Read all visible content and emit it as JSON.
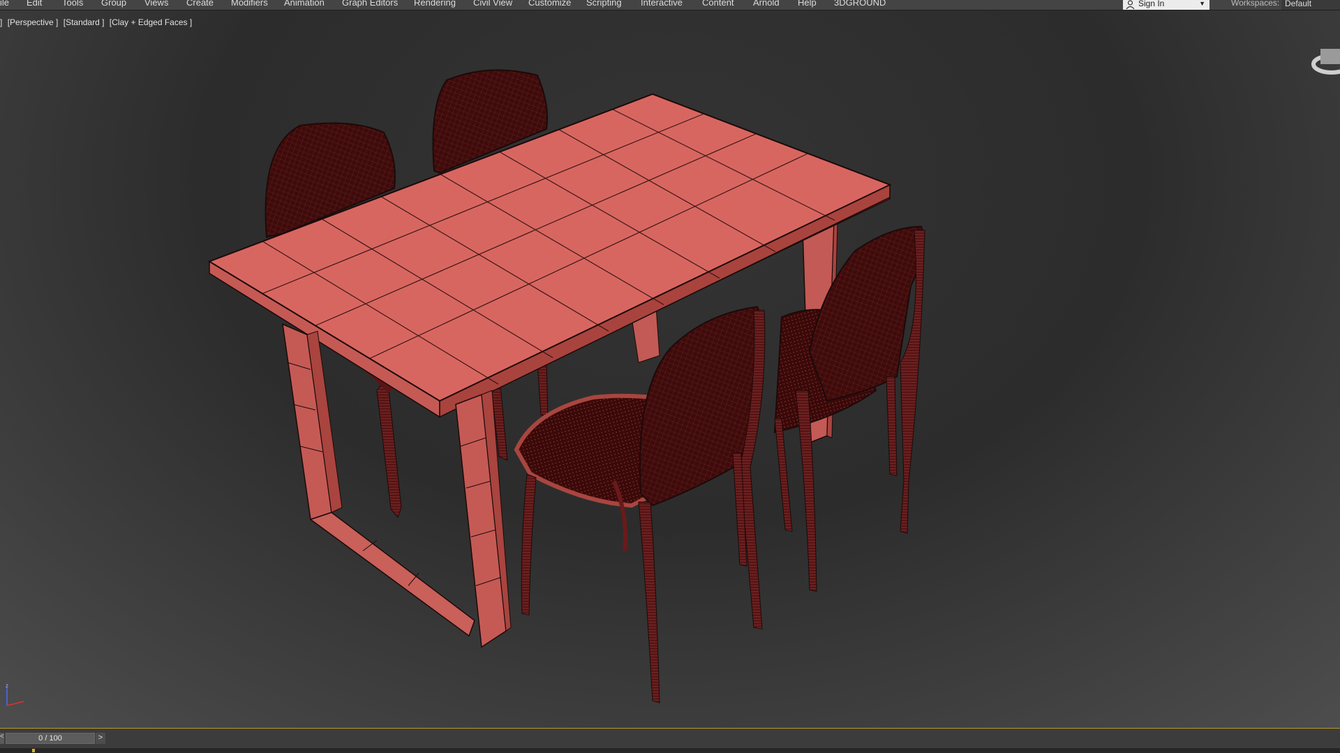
{
  "menu": [
    "ile",
    "Edit",
    "Tools",
    "Group",
    "Views",
    "Create",
    "Modifiers",
    "Animation",
    "Graph Editors",
    "Rendering",
    "Civil View",
    "Customize",
    "Scripting",
    "Interactive",
    "Content",
    "Arnold",
    "Help",
    "3DGROUND"
  ],
  "signin": {
    "label": "Sign In"
  },
  "workspaces": {
    "label": "Workspaces:",
    "value": "Default"
  },
  "viewport": {
    "labels": [
      "]",
      "[Perspective ]",
      "[Standard ]",
      "[Clay + Edged Faces ]"
    ]
  },
  "timeline": {
    "frame_display": "0 / 100",
    "prev": "<",
    "next": ">"
  },
  "colors": {
    "clay": "#d86660",
    "chair": "#3e0b0b",
    "edge": "#1c0a0a"
  }
}
